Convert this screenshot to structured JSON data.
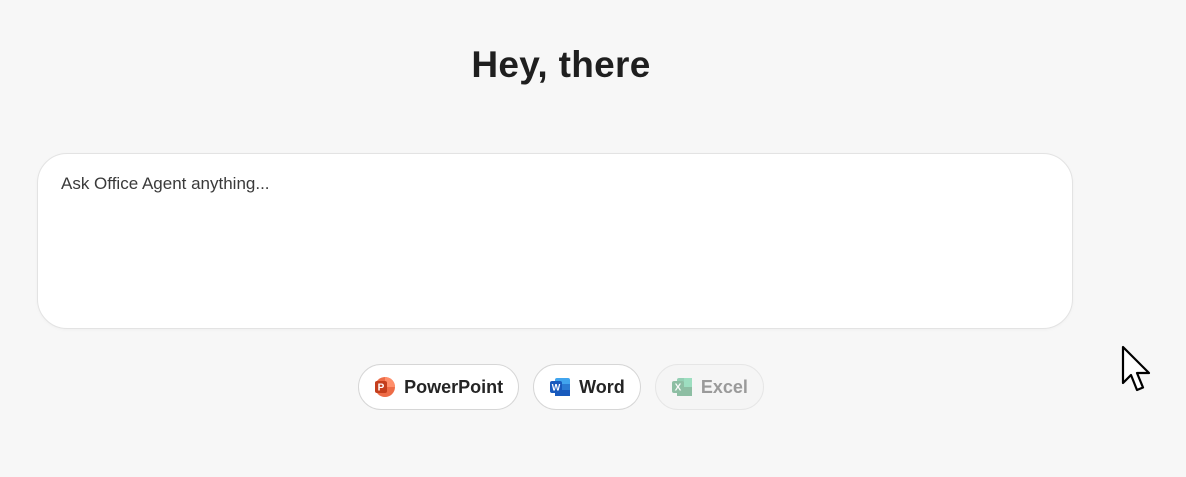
{
  "greeting": "Hey, there",
  "prompt": {
    "placeholder": "Ask Office Agent anything...",
    "value": ""
  },
  "apps": [
    {
      "label": "PowerPoint",
      "icon": "powerpoint-icon",
      "letter": "P",
      "color": "#c43e1c",
      "enabled": true
    },
    {
      "label": "Word",
      "icon": "word-icon",
      "letter": "W",
      "color": "#185abd",
      "enabled": true
    },
    {
      "label": "Excel",
      "icon": "excel-icon",
      "letter": "X",
      "color": "#107c41",
      "enabled": false
    }
  ],
  "pointer": "mouse-cursor-icon"
}
